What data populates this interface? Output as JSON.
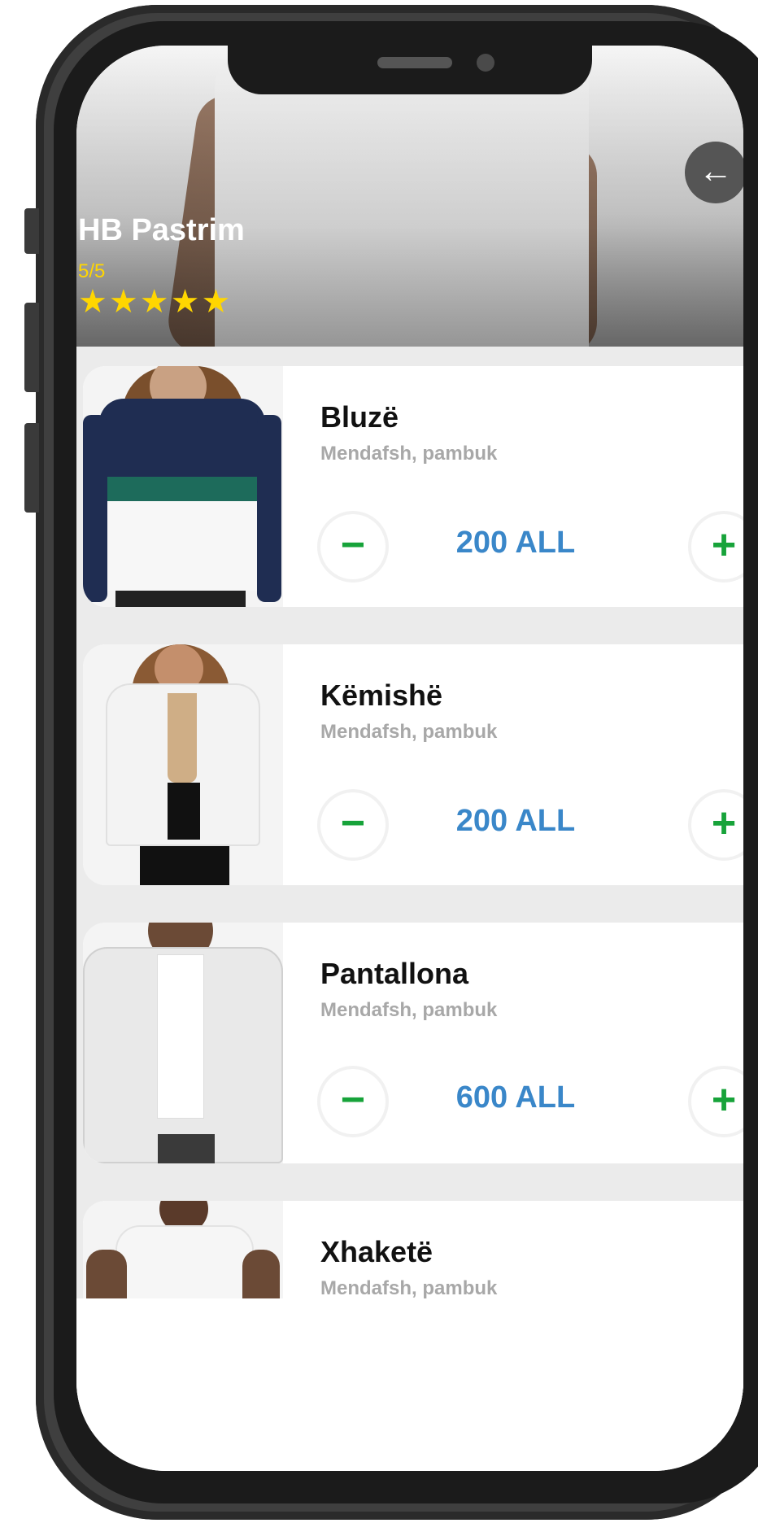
{
  "header": {
    "shop_name": "HB Pastrim",
    "rating": "5/5",
    "stars": "★★★★★",
    "back_icon": "arrow-left-icon"
  },
  "items": [
    {
      "title": "Bluzë",
      "subtitle": "Mendafsh, pambuk",
      "price": "200 ALL"
    },
    {
      "title": "Këmishë",
      "subtitle": "Mendafsh, pambuk",
      "price": "200 ALL"
    },
    {
      "title": "Pantallona",
      "subtitle": "Mendafsh, pambuk",
      "price": "600 ALL"
    },
    {
      "title": "Xhaketë",
      "subtitle": "Mendafsh, pambuk",
      "price": ""
    }
  ],
  "controls": {
    "minus": "−",
    "plus": "+",
    "back": "←"
  },
  "colors": {
    "accent_price": "#3a87c9",
    "button_green": "#17a33a",
    "star_yellow": "#ffd600"
  }
}
